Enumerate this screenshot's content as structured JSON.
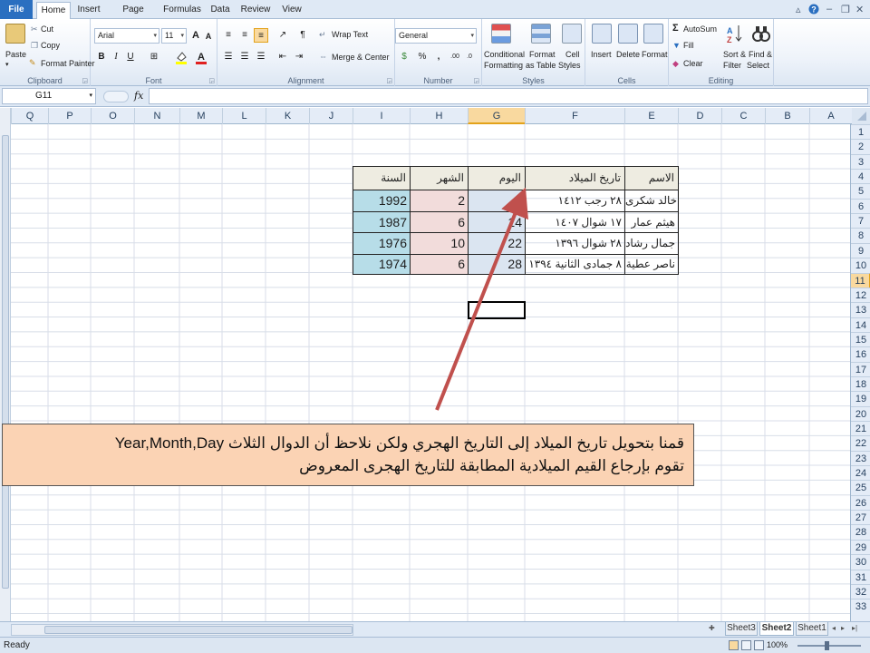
{
  "ribbon_tabs": [
    "File",
    "Home",
    "Insert",
    "Page Layout",
    "Formulas",
    "Data",
    "Review",
    "View"
  ],
  "active_tab": "Home",
  "clipboard": {
    "paste": "Paste",
    "cut": "Cut",
    "copy": "Copy",
    "format_painter": "Format Painter",
    "label": "Clipboard"
  },
  "font": {
    "name": "Arial",
    "size": "11",
    "bold": "B",
    "italic": "I",
    "underline": "U",
    "grow": "A",
    "shrink": "A",
    "label": "Font"
  },
  "alignment": {
    "wrap_text": "Wrap Text",
    "merge_center": "Merge & Center",
    "label": "Alignment"
  },
  "number": {
    "format": "General",
    "percent": "%",
    "comma": ",",
    "label": "Number"
  },
  "styles": {
    "conditional": "Conditional",
    "conditional2": "Formatting",
    "format_as": "Format",
    "format_as2": "as Table",
    "cell": "Cell",
    "cell2": "Styles",
    "label": "Styles"
  },
  "cells": {
    "insert": "Insert",
    "delete": "Delete",
    "format": "Format",
    "label": "Cells"
  },
  "editing": {
    "autosum": "AutoSum",
    "fill": "Fill",
    "clear": "Clear",
    "sort": "Sort &",
    "sort2": "Filter",
    "find": "Find &",
    "find2": "Select",
    "label": "Editing"
  },
  "formula_bar": {
    "name_box": "G11",
    "fx": "fx",
    "content": ""
  },
  "columns": [
    "Q",
    "P",
    "O",
    "N",
    "M",
    "L",
    "K",
    "J",
    "I",
    "H",
    "G",
    "F",
    "E",
    "D",
    "C",
    "B",
    "A"
  ],
  "rows": [
    "1",
    "2",
    "3",
    "4",
    "5",
    "6",
    "7",
    "8",
    "9",
    "10",
    "11",
    "12",
    "13",
    "14",
    "15",
    "16",
    "17",
    "18",
    "19",
    "20",
    "21",
    "22",
    "23",
    "24",
    "25",
    "26",
    "27",
    "28",
    "29",
    "30",
    "31",
    "32",
    "33"
  ],
  "selected_cell": {
    "column": "G",
    "row": "11"
  },
  "table": {
    "headers": {
      "name": "الاسم",
      "hijri": "تاريخ الميلاد",
      "day": "اليوم",
      "month": "الشهر",
      "year": "السنة"
    },
    "rows": [
      {
        "name": "خالد شكرى",
        "hijri": "٢٨ رجب ١٤١٢",
        "day": "1",
        "month": "2",
        "year": "1992"
      },
      {
        "name": "هيثم عمار",
        "hijri": "١٧ شوال ١٤٠٧",
        "day": "14",
        "month": "6",
        "year": "1987"
      },
      {
        "name": "جمال رشاد",
        "hijri": "٢٨ شوال ١٣٩٦",
        "day": "22",
        "month": "10",
        "year": "1976"
      },
      {
        "name": "ناصر عطية",
        "hijri": "٨ جمادى الثانية ١٣٩٤",
        "day": "28",
        "month": "6",
        "year": "1974"
      }
    ]
  },
  "colors": {
    "year_fill": "#b7dde8",
    "month_fill": "#f2dcdb",
    "day_fill": "#dbe5f1",
    "header_fill": "#eeece1",
    "callout_fill": "#fbd3b4",
    "arrow": "#c0504d"
  },
  "callout": {
    "line1": "قمنا بتحويل تاريخ الميلاد إلى التاريخ الهجري ولكن نلاحظ أن الدوال الثلاث Year,Month,Day",
    "line2": "تقوم بإرجاع القيم الميلادية المطابقة للتاريخ الهجرى المعروض"
  },
  "sheet_tabs": [
    "Sheet3",
    "Sheet2",
    "Sheet1"
  ],
  "active_sheet": "Sheet2",
  "status": {
    "ready": "Ready",
    "zoom": "100%"
  },
  "icons": [
    "paste-icon",
    "cut-icon",
    "copy-icon",
    "format-painter-icon",
    "fill-color-icon",
    "font-color-icon",
    "borders-icon",
    "conditional-formatting-icon",
    "format-table-icon",
    "cell-styles-icon",
    "insert-cells-icon",
    "delete-cells-icon",
    "format-cells-icon",
    "autosum-icon",
    "sort-filter-icon",
    "find-select-icon",
    "help-icon",
    "minimize-icon",
    "restore-icon",
    "close-icon"
  ]
}
